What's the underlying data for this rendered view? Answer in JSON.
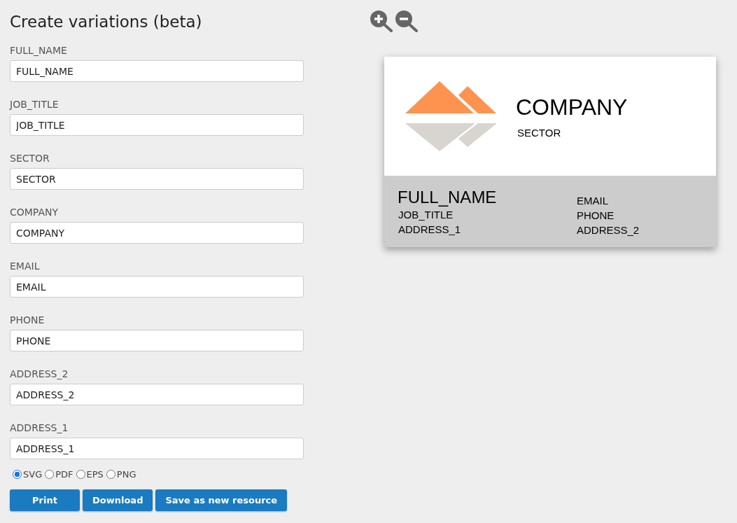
{
  "title": "Create variations (beta)",
  "fields": [
    {
      "label": "FULL_NAME",
      "value": "FULL_NAME"
    },
    {
      "label": "JOB_TITLE",
      "value": "JOB_TITLE"
    },
    {
      "label": "SECTOR",
      "value": "SECTOR"
    },
    {
      "label": "COMPANY",
      "value": "COMPANY"
    },
    {
      "label": "EMAIL",
      "value": "EMAIL"
    },
    {
      "label": "PHONE",
      "value": "PHONE"
    },
    {
      "label": "ADDRESS_2",
      "value": "ADDRESS_2"
    },
    {
      "label": "ADDRESS_1",
      "value": "ADDRESS_1"
    }
  ],
  "formats": [
    {
      "label": "SVG",
      "selected": true
    },
    {
      "label": "PDF",
      "selected": false
    },
    {
      "label": "EPS",
      "selected": false
    },
    {
      "label": "PNG",
      "selected": false
    }
  ],
  "buttons": [
    "Print",
    "Download",
    "Save as new resource"
  ],
  "card": {
    "company": "COMPANY",
    "sector": "SECTOR",
    "full_name": "FULL_NAME",
    "job_title": "JOB_TITLE",
    "address_1": "ADDRESS_1",
    "email": "EMAIL",
    "phone": "PHONE",
    "address_2": "ADDRESS_2"
  }
}
